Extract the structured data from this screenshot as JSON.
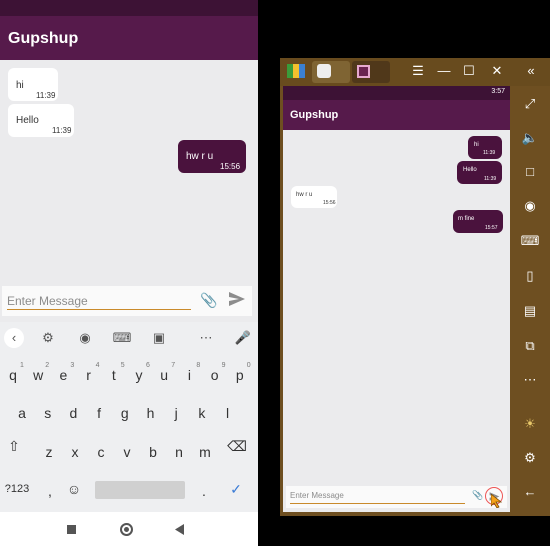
{
  "app": {
    "title": "Gupshup"
  },
  "left": {
    "messages": [
      {
        "dir": "in",
        "text": "hi",
        "time": "11:39"
      },
      {
        "dir": "in",
        "text": "Hello",
        "time": "11:39"
      },
      {
        "dir": "out",
        "text": "hw r u",
        "time": "15:56"
      }
    ],
    "input": {
      "placeholder": "Enter Message"
    }
  },
  "keyboard": {
    "row1": [
      "q",
      "w",
      "e",
      "r",
      "t",
      "y",
      "u",
      "i",
      "o",
      "p"
    ],
    "row1_nums": [
      "1",
      "2",
      "3",
      "4",
      "5",
      "6",
      "7",
      "8",
      "9",
      "0"
    ],
    "row2": [
      "a",
      "s",
      "d",
      "f",
      "g",
      "h",
      "j",
      "k",
      "l"
    ],
    "row3": [
      "z",
      "x",
      "c",
      "v",
      "b",
      "n",
      "m"
    ],
    "mode_key": "?123",
    "comma": ",",
    "period": "."
  },
  "right": {
    "status_time": "3:57",
    "messages": [
      {
        "dir": "out",
        "text": "hi",
        "time": "11:39"
      },
      {
        "dir": "out",
        "text": "Hello",
        "time": "11:39"
      },
      {
        "dir": "in",
        "text": "hw r u",
        "time": "15:56"
      },
      {
        "dir": "out",
        "text": "m fine",
        "time": "15:57"
      }
    ],
    "input": {
      "placeholder": "Enter Message"
    }
  },
  "colors": {
    "primary": "#561a4b",
    "primary_dark": "#3d1235",
    "bubble_out": "#4a123d",
    "accent": "#c98a2b",
    "emulator_frame": "#6e4f21"
  },
  "icons": {
    "keyboard_tools": [
      "chevron-left-icon",
      "gear-icon",
      "palette-icon",
      "keyboard-icon",
      "image-icon",
      "more-icon",
      "mic-icon"
    ],
    "emulator_sidebar": [
      "fullscreen-icon",
      "volume-icon",
      "screenshot-icon",
      "eye-icon",
      "keymap-icon",
      "phone-icon",
      "apk-icon",
      "share-icon",
      "more-icon",
      "brightness-icon",
      "settings-icon",
      "back-icon"
    ],
    "emulator_titlebar": [
      "menu-icon",
      "minimize-icon",
      "maximize-icon",
      "close-icon",
      "collapse-icon"
    ]
  }
}
